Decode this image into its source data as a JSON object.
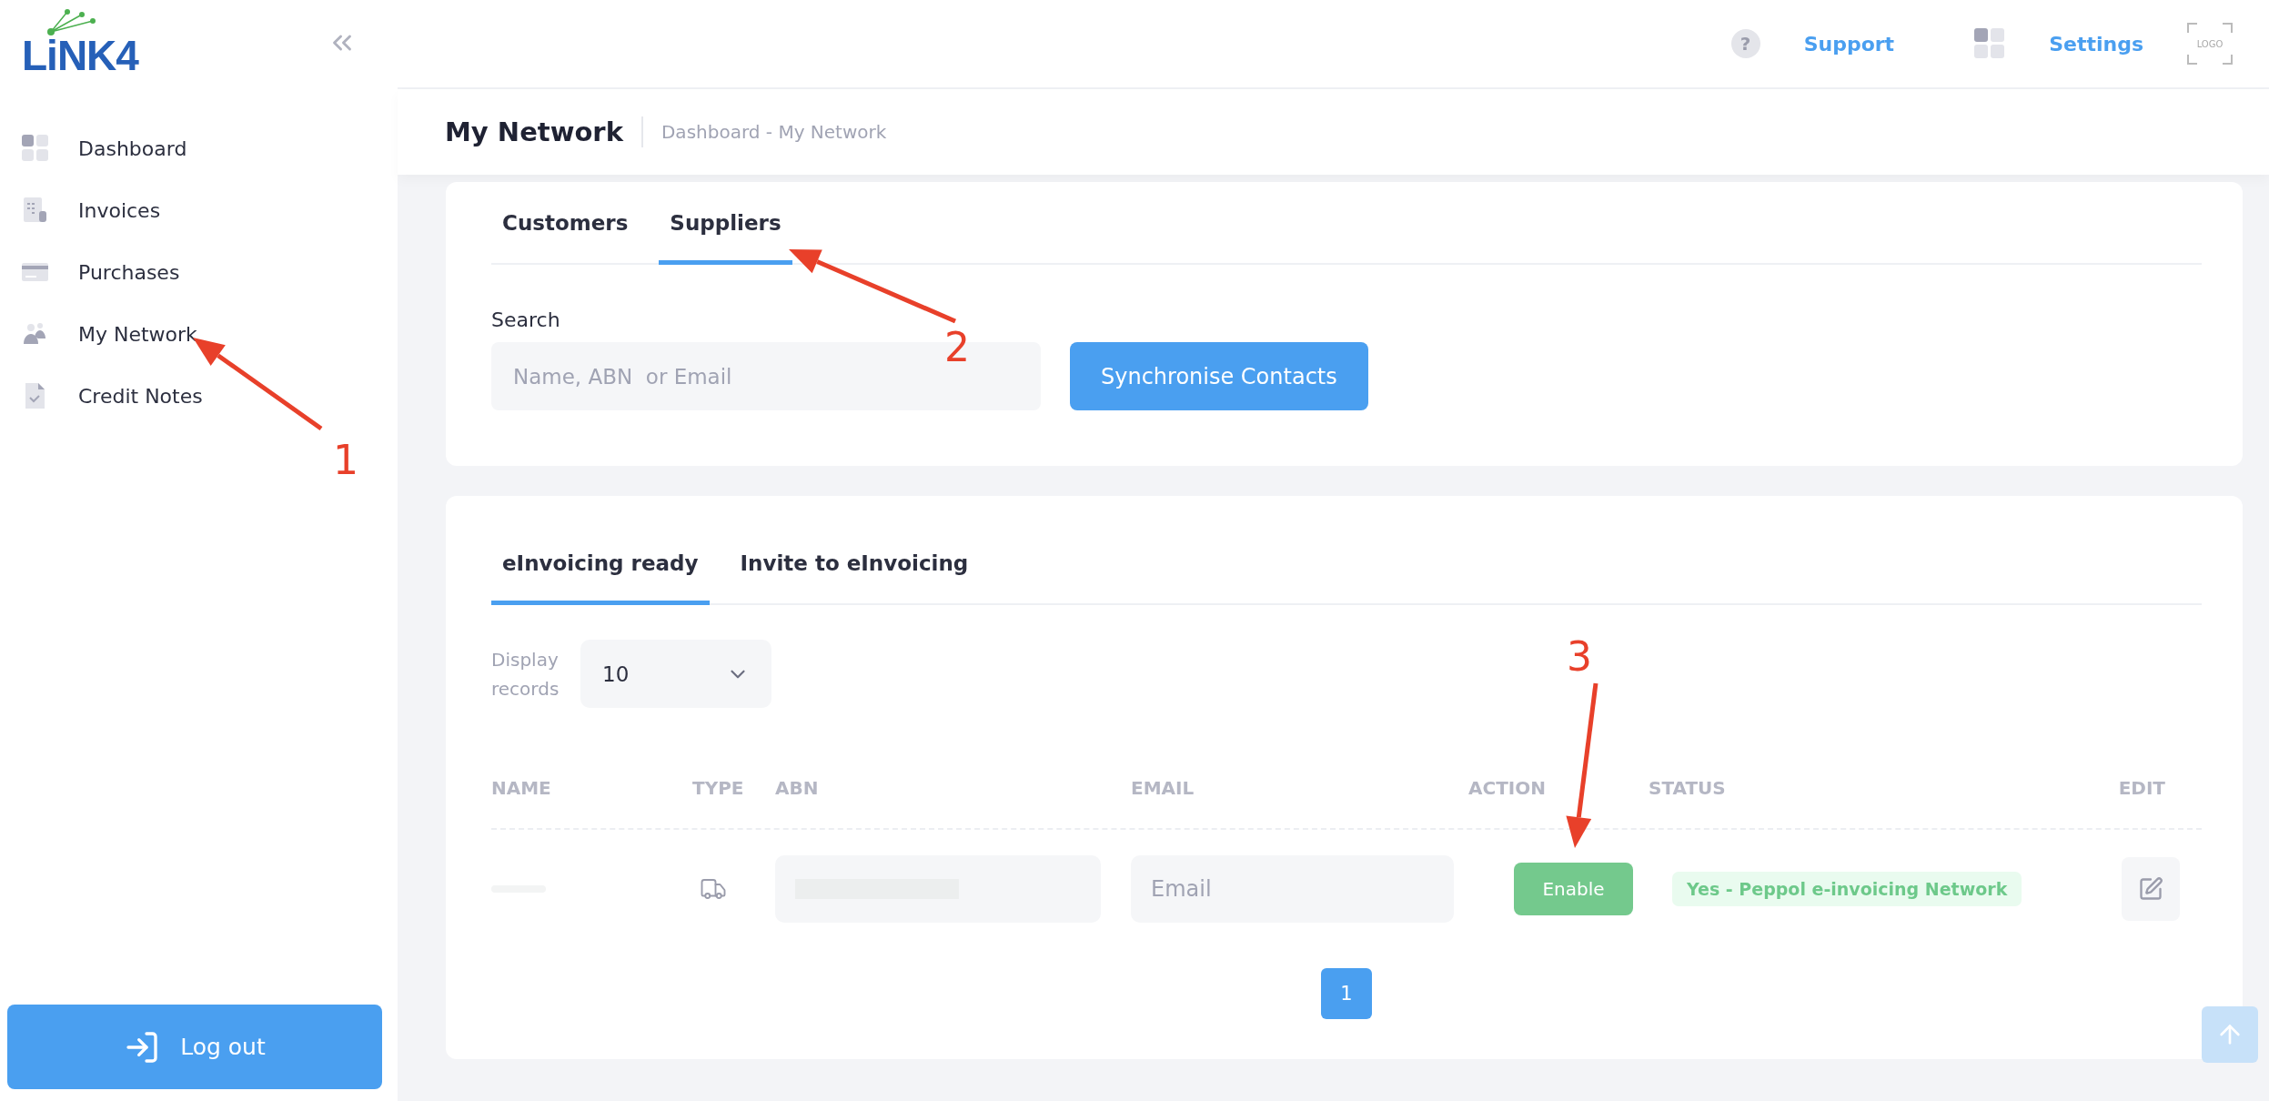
{
  "sidebar": {
    "logo": "LiNK4",
    "items": [
      {
        "label": "Dashboard",
        "kind": "dashboard"
      },
      {
        "label": "Invoices",
        "kind": "invoices"
      },
      {
        "label": "Purchases",
        "kind": "purchases"
      },
      {
        "label": "My Network",
        "kind": "network"
      },
      {
        "label": "Credit Notes",
        "kind": "credit"
      }
    ],
    "logout": "Log out"
  },
  "header": {
    "help": "?",
    "support": "Support",
    "settings": "Settings",
    "logo_placeholder": "LOGO"
  },
  "page": {
    "title": "My Network",
    "breadcrumb": "Dashboard - My Network"
  },
  "contact_tabs": [
    {
      "label": "Customers",
      "selected": false
    },
    {
      "label": "Suppliers",
      "selected": true
    }
  ],
  "search": {
    "label": "Search",
    "placeholder": "Name, ABN  or Email"
  },
  "sync_button": "Synchronise Contacts",
  "list_tabs": [
    {
      "label": "eInvoicing ready",
      "selected": true
    },
    {
      "label": "Invite to eInvoicing",
      "selected": false
    }
  ],
  "display_records": {
    "label": "Display records",
    "value": "10"
  },
  "table": {
    "columns": [
      "NAME",
      "TYPE",
      "ABN",
      "EMAIL",
      "ACTION",
      "STATUS",
      "EDIT"
    ],
    "rows": [
      {
        "email_placeholder": "Email",
        "action": "Enable",
        "status": "Yes - Peppol e-invoicing Network"
      }
    ]
  },
  "pagination": [
    {
      "label": "1",
      "selected": true
    }
  ],
  "annotations": [
    {
      "label": "1"
    },
    {
      "label": "2"
    },
    {
      "label": "3"
    }
  ]
}
